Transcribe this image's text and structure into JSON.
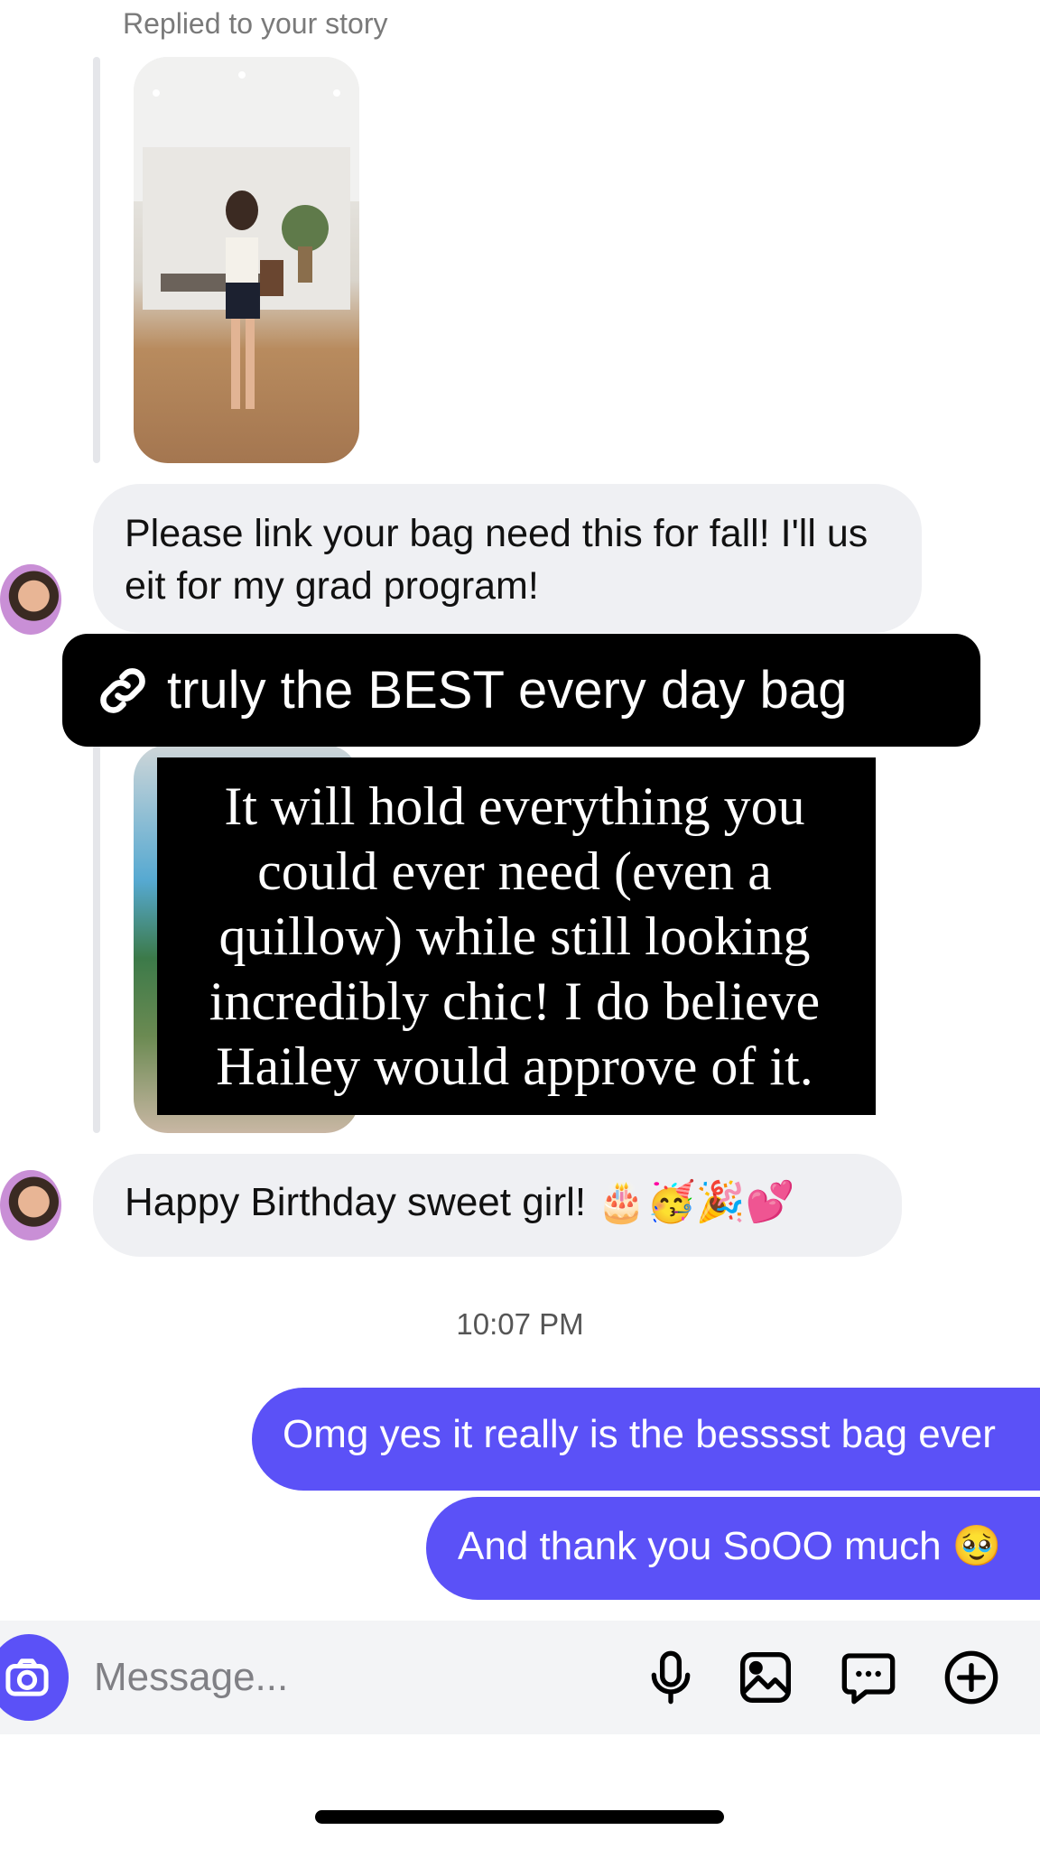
{
  "thread": {
    "replied_label": "Replied to your story",
    "incoming_messages": [
      {
        "text": "Please link your bag need this for fall! I'll us eit for my grad program!"
      },
      {
        "text": "Happy Birthday sweet girl! 🎂🥳🎉💕"
      }
    ],
    "story_reply": {
      "link_sticker_text": "truly the BEST every day bag",
      "caption_text": "It will hold everything you could ever need (even a quillow) while still looking incredibly chic! I do believe Hailey would approve of it."
    },
    "timestamp": "10:07 PM",
    "outgoing_messages": [
      {
        "text": "Omg yes it really is the besssst bag ever"
      },
      {
        "text": "And thank you SoOO much 🥹"
      }
    ]
  },
  "composer": {
    "placeholder": "Message...",
    "icons": [
      "camera-icon",
      "microphone-icon",
      "gallery-icon",
      "sticker-chat-icon",
      "plus-icon"
    ]
  },
  "colors": {
    "outgoing_bubble": "#5b51f7",
    "incoming_bubble": "#eff0f3"
  }
}
